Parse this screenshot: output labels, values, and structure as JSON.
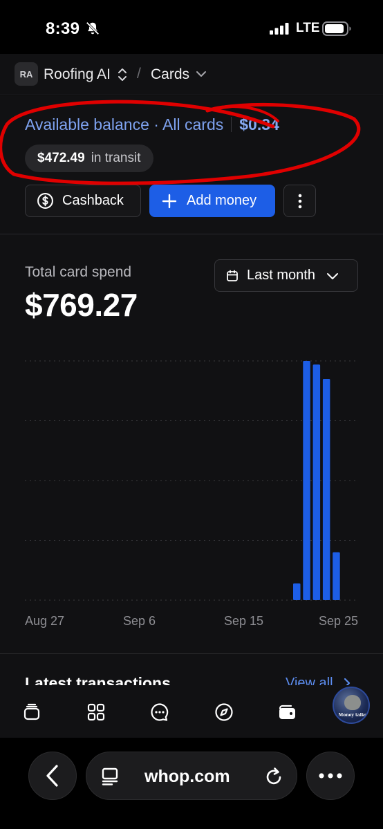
{
  "status_bar": {
    "time": "8:39",
    "network": "LTE"
  },
  "header": {
    "org_initials": "RA",
    "org_name": "Roofing AI",
    "separator": "/",
    "page": "Cards"
  },
  "balance": {
    "label": "Available balance · All cards",
    "amount": "$0.34",
    "transit_amount": "$472.49",
    "transit_label": "in transit"
  },
  "actions": {
    "cashback": "Cashback",
    "add_money": "Add money"
  },
  "spend": {
    "label": "Total card spend",
    "value": "$769.27",
    "range": "Last month"
  },
  "chart_data": {
    "type": "bar",
    "x_labels": [
      "Aug 27",
      "Sep 6",
      "Sep 15",
      "Sep 25"
    ],
    "bars": [
      {
        "day": "Sep 21",
        "relative": 0.07
      },
      {
        "day": "Sep 22",
        "relative": 1.0
      },
      {
        "day": "Sep 23",
        "relative": 0.985
      },
      {
        "day": "Sep 24",
        "relative": 0.925
      },
      {
        "day": "Sep 25",
        "relative": 0.2
      }
    ],
    "gridlines": 5,
    "bar_color": "#1d5ee6"
  },
  "transactions": {
    "title": "Latest transactions",
    "view_all": "View all"
  },
  "browser": {
    "url": "whop.com"
  },
  "profile": {
    "caption": "Money talks"
  },
  "colors": {
    "accent": "#1d5ee6",
    "link": "#7ea2ef",
    "annotation": "#e00000"
  }
}
